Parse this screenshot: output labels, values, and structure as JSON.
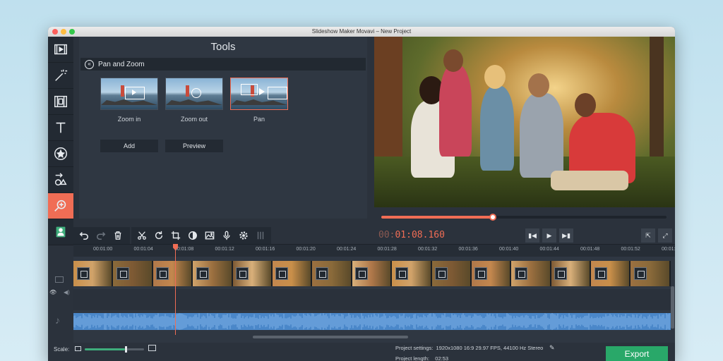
{
  "window": {
    "title": "Slideshow Maker Movavi – New Project"
  },
  "sidebar": {
    "items": [
      {
        "name": "import",
        "icon": "film-import-icon"
      },
      {
        "name": "filters",
        "icon": "magic-wand-icon"
      },
      {
        "name": "transitions",
        "icon": "film-strip-icon"
      },
      {
        "name": "titles",
        "icon": "text-T-icon"
      },
      {
        "name": "stickers",
        "icon": "star-badge-icon"
      },
      {
        "name": "shapes",
        "icon": "shapes-icon"
      },
      {
        "name": "zoom",
        "icon": "zoom-icon",
        "active": true
      },
      {
        "name": "more",
        "icon": "person-icon"
      }
    ]
  },
  "tools": {
    "title": "Tools",
    "section_title": "Pan and Zoom",
    "effects": [
      {
        "label": "Zoom in"
      },
      {
        "label": "Zoom out"
      },
      {
        "label": "Pan",
        "selected": true
      }
    ],
    "add_label": "Add",
    "preview_label": "Preview"
  },
  "player": {
    "progress": 0.39,
    "timecode_dim": "00:",
    "timecode_main": "01:08.160"
  },
  "timeline": {
    "ticks": [
      "00:01:00",
      "00:01:04",
      "00:01:08",
      "00:01:12",
      "00:01:16",
      "00:01:20",
      "00:01:24",
      "00:01:28",
      "00:01:32",
      "00:01:36",
      "00:01:40",
      "00:01:44",
      "00:01:48",
      "00:01:52",
      "00:01:56"
    ],
    "clip_count": 15
  },
  "bottom": {
    "scale_label": "Scale:",
    "scale_value": 0.68,
    "project_settings_label": "Project settings:",
    "project_settings_value": "1920x1080 16:9 29.97 FPS, 44100 Hz Stereo",
    "project_length_label": "Project length:",
    "project_length_value": "02:53",
    "export_label": "Export"
  },
  "colors": {
    "accent": "#f06d55",
    "export": "#29a869",
    "audio": "#4a87c9"
  }
}
